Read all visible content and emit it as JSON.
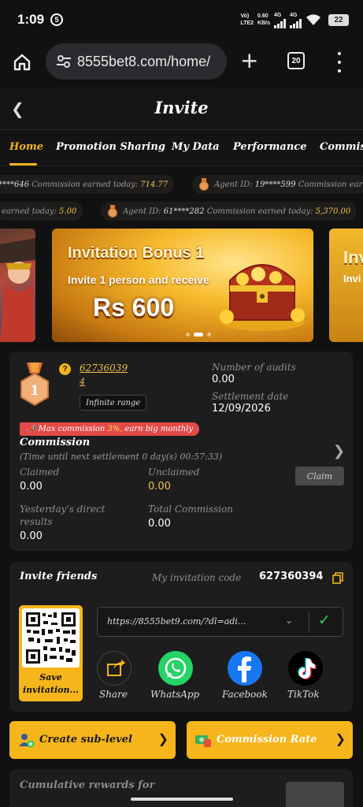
{
  "status": {
    "time": "1:09",
    "badge": "5",
    "net1": "Vo)",
    "net2": "LTE2",
    "speed": "0.60",
    "speed_unit": "KB/s",
    "net3": "4G",
    "net4": "4G",
    "battery": "22"
  },
  "browser": {
    "url": "8555bet8.com/home/",
    "tab_count": "20"
  },
  "header": {
    "title": "Invite"
  },
  "tabs": [
    "Home",
    "Promotion Sharing",
    "My Data",
    "Performance",
    "Commiss"
  ],
  "ticker_top": [
    {
      "id": "****646",
      "label": "Commission earned today:",
      "value": "714.77"
    },
    {
      "agent_label": "Agent ID:",
      "id": "19****599",
      "label": "Commission ear"
    }
  ],
  "ticker_bottom": [
    {
      "label": "earned today:",
      "value": "5.00"
    },
    {
      "agent_label": "Agent ID:",
      "id": "61****282",
      "label": "Commission earned today:",
      "value": "5,370.00"
    }
  ],
  "banner": {
    "title": "Invitation Bonus 1",
    "subtitle": "Invite 1 person and receive",
    "amount": "Rs 600",
    "peek_title": "Invi",
    "peek_sub": "Invi"
  },
  "profile": {
    "level": "1",
    "user_id": "62736039",
    "user_id_2": "4",
    "range": "Infinite range",
    "audits_label": "Number of audits",
    "audits_value": "0.00",
    "settlement_label": "Settlement date",
    "settlement_value": "12/09/2026"
  },
  "commission": {
    "badge_prefix": "Max commission",
    "badge_pct": "3%,",
    "badge_suffix": "earn big monthly",
    "title": "Commission",
    "subtitle": "(Time until next settlement  0 day(s) 00:57:33)",
    "claimed_label": "Claimed",
    "claimed_value": "0.00",
    "unclaimed_label": "Unclaimed",
    "unclaimed_value": "0.00",
    "claim_button": "Claim",
    "yesterday_label_1": "Yesterday's direct",
    "yesterday_label_2": "results",
    "yesterday_value": "0.00",
    "total_label": "Total Commission",
    "total_value": "0.00"
  },
  "invite": {
    "title": "Invite friends",
    "code_label": "My invitation code",
    "code": "627360394",
    "qr_label_1": "Save",
    "qr_label_2": "invitation...",
    "link": "https://8555bet9.com/?dl=adi...",
    "share": [
      {
        "label": "Share",
        "color": "#2a2a2a"
      },
      {
        "label": "WhatsApp",
        "color": "#25d366"
      },
      {
        "label": "Facebook",
        "color": "#1877f2"
      },
      {
        "label": "TikTok",
        "color": "#000000"
      }
    ]
  },
  "actions": {
    "sublevel": "Create sub-level",
    "rate": "Commission Rate"
  },
  "cumulative": {
    "title": "Cumulative rewards for"
  },
  "colors": {
    "accent": "#f5b51b",
    "badge_red": "#e24a48",
    "card": "#1d1d1d",
    "bg": "#111111",
    "success": "#2ecc55"
  }
}
